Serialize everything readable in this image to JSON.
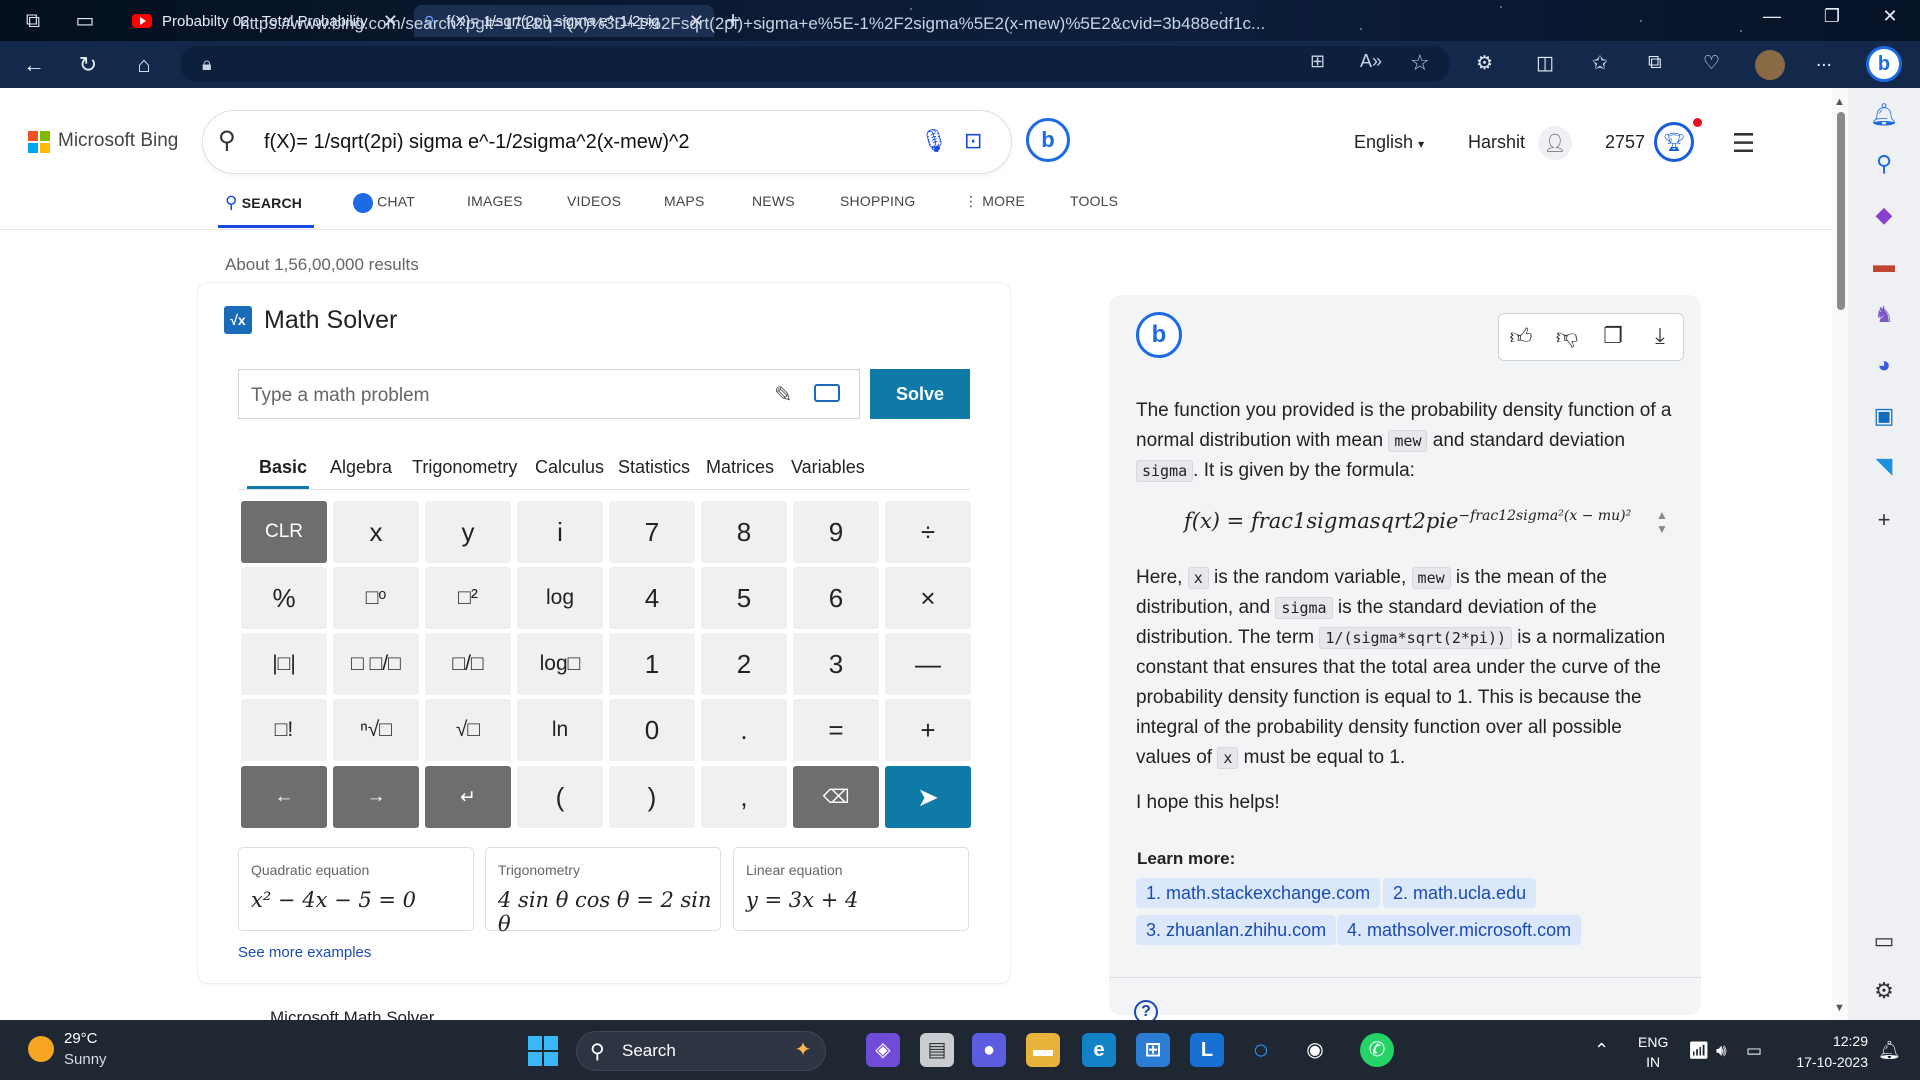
{
  "browser": {
    "tabs": [
      {
        "title": "Probabilty 02 : Total Probability",
        "close": "✕"
      },
      {
        "title": "f(X)= 1/sqrt(2pi) sigma e^-1/2sig",
        "close": "✕"
      }
    ],
    "new_tab": "+",
    "url": "https://www.bing.com/search?pglt=171&q=f(X)%3D+1%2Fsqrt(2pi)+sigma+e%5E-1%2F2sigma%5E2(x-mew)%5E2&cvid=3b488edf1c...",
    "more_label": "..."
  },
  "bing": {
    "brand": "Microsoft Bing",
    "query": "f(X)= 1/sqrt(2pi) sigma e^-1/2sigma^2(x-mew)^2",
    "language": "English",
    "user": "Harshit",
    "points": "2757",
    "nav": [
      "SEARCH",
      "CHAT",
      "IMAGES",
      "VIDEOS",
      "MAPS",
      "NEWS",
      "SHOPPING",
      "MORE",
      "TOOLS"
    ],
    "results_count": "About 1,56,00,000 results"
  },
  "math_solver": {
    "title": "Math Solver",
    "input_placeholder": "Type a math problem",
    "solve_label": "Solve",
    "tabs": [
      "Basic",
      "Algebra",
      "Trigonometry",
      "Calculus",
      "Statistics",
      "Matrices",
      "Variables"
    ],
    "keys": [
      [
        "CLR",
        "x",
        "y",
        "i",
        "7",
        "8",
        "9",
        "÷"
      ],
      [
        "%",
        "□ᵒ",
        "□²",
        "log",
        "4",
        "5",
        "6",
        "×"
      ],
      [
        "|□|",
        "□ □/□",
        "□/□",
        "log□",
        "1",
        "2",
        "3",
        "—"
      ],
      [
        "□!",
        "ⁿ√□",
        "√□",
        "ln",
        "0",
        ".",
        "=",
        "+"
      ],
      [
        "←",
        "→",
        "↵",
        "(",
        ")",
        ",",
        "⌫",
        "➤"
      ]
    ],
    "examples": [
      {
        "label": "Quadratic equation",
        "expr": "x² − 4x − 5 = 0"
      },
      {
        "label": "Trigonometry",
        "expr": "4 sin θ cos θ = 2 sin θ"
      },
      {
        "label": "Linear equation",
        "expr": "y = 3x + 4"
      }
    ],
    "see_more": "See more examples",
    "footer_cut": "Microsoft Math Solver"
  },
  "copilot": {
    "p1_a": "The function you provided is the probability density function of a normal distribution with mean ",
    "p1_code1": "mew",
    "p1_b": " and standard deviation ",
    "p1_code2": "sigma",
    "p1_c": ". It is given by the formula:",
    "formula_main": "f(x) = frac1sigmasqrt2pie",
    "formula_sup": "−frac12sigma²(x − mu)²",
    "p2_a": "Here, ",
    "p2_code1": "x",
    "p2_b": " is the random variable, ",
    "p2_code2": "mew",
    "p2_c": " is the mean of the distribution, and ",
    "p2_code3": "sigma",
    "p2_d": " is the standard deviation of the distribution. The term ",
    "p2_code4": "1/(sigma*sqrt(2*pi))",
    "p2_e": " is a normalization constant that ensures that the total area under the curve of the probability density function is equal to 1. This is because the integral of the probability density function over all possible values of ",
    "p2_code5": "x",
    "p2_f": " must be equal to 1.",
    "p3": "I hope this helps!",
    "learn_more": "Learn more:",
    "links": [
      "1. math.stackexchange.com",
      "2. math.ucla.edu",
      "3. zhuanlan.zhihu.com",
      "4. mathsolver.microsoft.com"
    ]
  },
  "taskbar": {
    "temperature": "29°C",
    "condition": "Sunny",
    "search": "Search",
    "lang_top": "ENG",
    "lang_bottom": "IN",
    "time": "12:29",
    "date": "17-10-2023"
  },
  "colors": {
    "bing_blue": "#174ae4",
    "solver_accent": "#0f7aa8",
    "link_blue": "#1a4bb5",
    "titlebar": "#0b1a33"
  }
}
